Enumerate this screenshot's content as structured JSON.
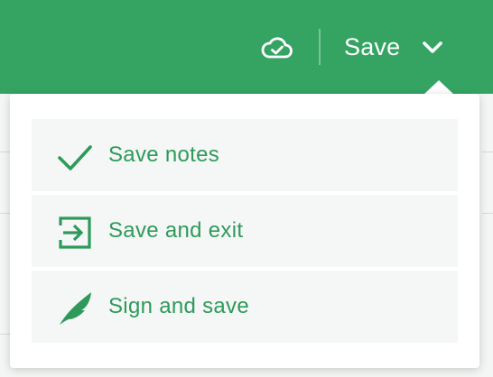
{
  "header": {
    "save_label": "Save",
    "accent_color": "#35a463",
    "icons": {
      "cloud": "cloud-check-icon",
      "chevron": "chevron-down-icon"
    }
  },
  "save_menu": {
    "items": [
      {
        "label": "Save notes",
        "icon": "checkmark-icon"
      },
      {
        "label": "Save and exit",
        "icon": "exit-icon"
      },
      {
        "label": "Sign and save",
        "icon": "quill-icon"
      }
    ],
    "text_color": "#2e9a5a"
  }
}
